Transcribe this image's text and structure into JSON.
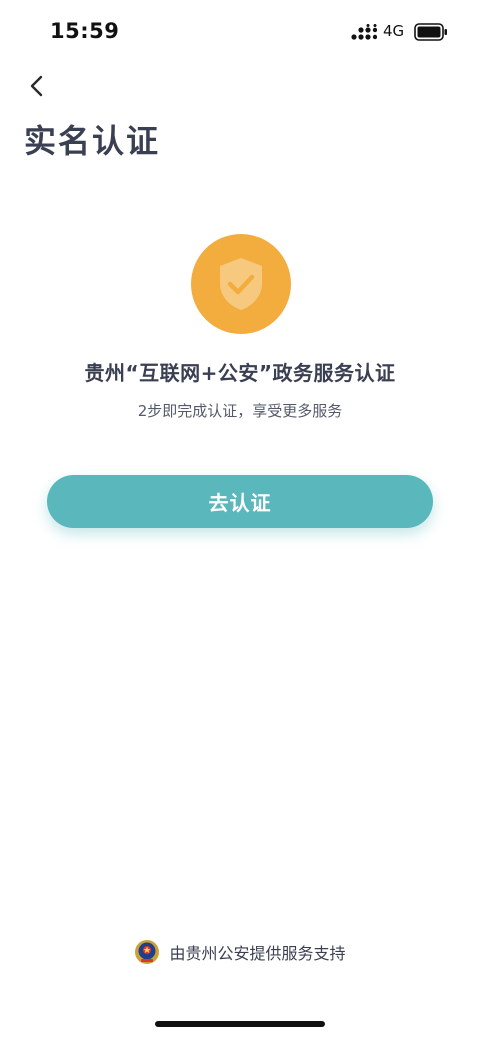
{
  "status_bar": {
    "time": "15:59",
    "network": "4G",
    "icons": [
      "signal-icon",
      "battery-icon"
    ]
  },
  "nav": {
    "back_icon": "chevron-left-icon"
  },
  "page": {
    "title": "实名认证"
  },
  "hero": {
    "icon": "shield-check-icon",
    "heading": "贵州“互联网+公安”政务服务认证",
    "subtext": "2步即完成认证，享受更多服务"
  },
  "actions": {
    "verify_label": "去认证"
  },
  "footer": {
    "icon": "police-emblem-icon",
    "text": "由贵州公安提供服务支持"
  },
  "colors": {
    "accent": "#5ab8bd",
    "badge": "#f3ac3e",
    "title_text": "#3a3f52"
  }
}
